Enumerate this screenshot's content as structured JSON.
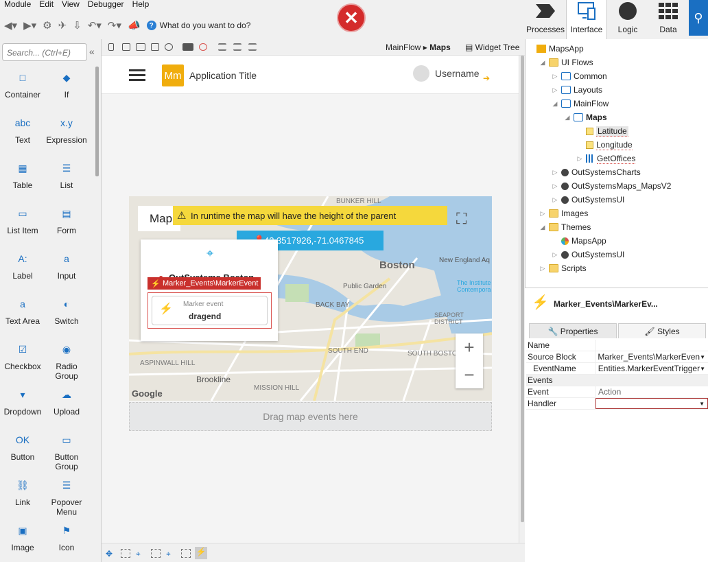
{
  "menu": [
    "Module",
    "Edit",
    "View",
    "Debugger",
    "Help"
  ],
  "toolbar": {
    "ask_placeholder": "What do you want to do?",
    "help_icon": "?"
  },
  "error_icon": "✕",
  "top_tabs": [
    {
      "label": "Processes",
      "icon": "processes-icon"
    },
    {
      "label": "Interface",
      "icon": "interface-icon"
    },
    {
      "label": "Logic",
      "icon": "logic-icon"
    },
    {
      "label": "Data",
      "icon": "data-icon"
    }
  ],
  "search_icon": "⚲",
  "left_panel": {
    "search_placeholder": "Search... (Ctrl+E)",
    "collapse_icon": "«",
    "widgets": [
      {
        "label": "Container",
        "icon": "□"
      },
      {
        "label": "If",
        "icon": "◆"
      },
      {
        "label": "Text",
        "icon": "abc"
      },
      {
        "label": "Expression",
        "icon": "x.y"
      },
      {
        "label": "Table",
        "icon": "▦"
      },
      {
        "label": "List",
        "icon": "☰"
      },
      {
        "label": "List Item",
        "icon": "▭"
      },
      {
        "label": "Form",
        "icon": "▤"
      },
      {
        "label": "Label",
        "icon": "A:"
      },
      {
        "label": "Input",
        "icon": "a"
      },
      {
        "label": "Text Area",
        "icon": "a"
      },
      {
        "label": "Switch",
        "icon": "◐"
      },
      {
        "label": "Checkbox",
        "icon": "☑"
      },
      {
        "label": "Radio Group",
        "icon": "◉"
      },
      {
        "label": "Dropdown",
        "icon": "▾"
      },
      {
        "label": "Upload",
        "icon": "☁"
      },
      {
        "label": "Button",
        "icon": "OK"
      },
      {
        "label": "Button Group",
        "icon": "▭"
      },
      {
        "label": "Link",
        "icon": "⛓"
      },
      {
        "label": "Popover Menu",
        "icon": "☰"
      },
      {
        "label": "Image",
        "icon": "▣"
      },
      {
        "label": "Icon",
        "icon": "⚑"
      }
    ]
  },
  "subbar": {
    "breadcrumb_parent": "MainFlow",
    "breadcrumb_sep": "▸",
    "breadcrumb_current": "Maps",
    "widget_tree": "Widget Tree"
  },
  "app": {
    "logo": "Mm",
    "title": "Application Title",
    "username": "Username"
  },
  "map": {
    "title_partial": "Map",
    "notice": "In runtime the map will have the height of the parent",
    "coordinates": "42.3517926,-71.0467845",
    "marker_title": "OutSystems Boston",
    "marker_event_badge": "Marker_Events\\MarkerEvent",
    "marker_event_label": "Marker event",
    "marker_event_value": "dragend",
    "zoom_in": "+",
    "zoom_out": "−",
    "attribution": "Google",
    "places": [
      "BUNKER HILL",
      "Boston",
      "Public Garden",
      "BACK BAY",
      "New England Aq",
      "SEAPORT DISTRICT",
      "SOUTH END",
      "SOUTH BOSTON",
      "Brookline",
      "MISSION HILL",
      "ASPINWALL HILL",
      "The Institute Contempora"
    ]
  },
  "drag_area": "Drag map events here",
  "tree": [
    {
      "label": "MapsApp",
      "level": 0,
      "icon": "app",
      "toggle": ""
    },
    {
      "label": "UI Flows",
      "level": 1,
      "icon": "folder",
      "toggle": "◢"
    },
    {
      "label": "Common",
      "level": 2,
      "icon": "screen",
      "toggle": "▷"
    },
    {
      "label": "Layouts",
      "level": 2,
      "icon": "screen",
      "toggle": "▷"
    },
    {
      "label": "MainFlow",
      "level": 2,
      "icon": "screen",
      "toggle": "◢"
    },
    {
      "label": "Maps",
      "level": 3,
      "icon": "screen",
      "toggle": "◢",
      "bold": true
    },
    {
      "label": "Latitude",
      "level": 4,
      "icon": "sq",
      "toggle": "",
      "selected": true
    },
    {
      "label": "Longitude",
      "level": 4,
      "icon": "sq",
      "toggle": ""
    },
    {
      "label": "GetOffices",
      "level": 4,
      "icon": "grid",
      "toggle": "▷"
    },
    {
      "label": "OutSystemsCharts",
      "level": 2,
      "icon": "circ",
      "toggle": "▷"
    },
    {
      "label": "OutSystemsMaps_MapsV2",
      "level": 2,
      "icon": "circ",
      "toggle": "▷"
    },
    {
      "label": "OutSystemsUI",
      "level": 2,
      "icon": "circ",
      "toggle": "▷"
    },
    {
      "label": "Images",
      "level": 1,
      "icon": "folder",
      "toggle": "▷"
    },
    {
      "label": "Themes",
      "level": 1,
      "icon": "folder",
      "toggle": "◢"
    },
    {
      "label": "MapsApp",
      "level": 2,
      "icon": "theme",
      "toggle": ""
    },
    {
      "label": "OutSystemsUI",
      "level": 2,
      "icon": "circ",
      "toggle": "▷"
    },
    {
      "label": "Scripts",
      "level": 1,
      "icon": "folder",
      "toggle": "▷"
    }
  ],
  "properties": {
    "title": "Marker_Events\\MarkerEv...",
    "tab_properties": "Properties",
    "tab_styles": "Styles",
    "rows": [
      {
        "key": "Name",
        "value": "",
        "section": false,
        "dropdown": false
      },
      {
        "key": "Source Block",
        "value": "Marker_Events\\MarkerEven",
        "section": false,
        "dropdown": true
      },
      {
        "key": "EventName",
        "value": "Entities.MarkerEventTrigger",
        "section": false,
        "dropdown": true
      },
      {
        "key": "Events",
        "value": "",
        "section": true,
        "dropdown": false
      },
      {
        "key": "Event",
        "value": "Action",
        "section": false,
        "dropdown": false
      },
      {
        "key": "Handler",
        "value": "",
        "section": false,
        "dropdown": true,
        "error": true
      }
    ]
  }
}
